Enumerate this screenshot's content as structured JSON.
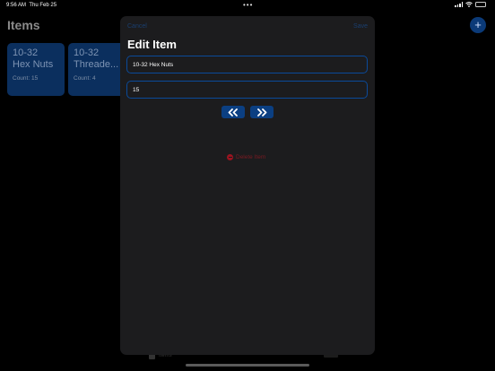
{
  "status_bar": {
    "time": "9:56 AM",
    "date": "Thu Feb 25",
    "dots": "•••"
  },
  "background": {
    "title": "Items",
    "add_button": "+",
    "cards": [
      {
        "line1": "10-32",
        "line2": "Hex Nuts",
        "count": "Count: 15"
      },
      {
        "line1": "10-32",
        "line2": "Threade...",
        "count": "Count: 4"
      }
    ],
    "tab_label": "Items"
  },
  "sheet": {
    "cancel_label": "Cancel",
    "save_label": "Save",
    "title": "Edit Item",
    "name_value": "10-32 Hex Nuts",
    "count_value": "15",
    "delete_label": "Delete Item"
  },
  "icons": {
    "decrement": "chevron-double-left-icon",
    "increment": "chevron-double-right-icon",
    "delete": "minus-circle-icon"
  },
  "colors": {
    "accent": "#0b3f82",
    "field_border": "#0a4a9a",
    "destructive": "#9a1420",
    "sheet_background": "#1c1c1e"
  }
}
